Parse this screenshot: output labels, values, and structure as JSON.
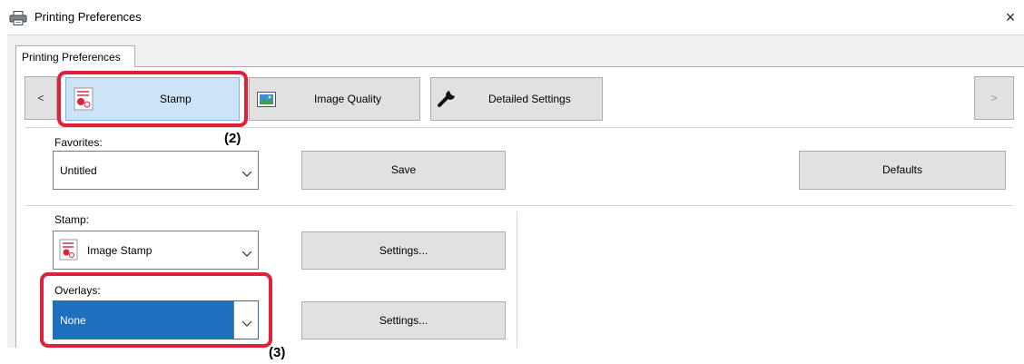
{
  "window": {
    "title": "Printing Preferences",
    "close_glyph": "×",
    "icon": "printer-icon"
  },
  "tab": {
    "label": "Printing Preferences"
  },
  "tabstrip": {
    "prev_glyph": "<",
    "next_glyph": ">",
    "buttons": [
      {
        "label": "Stamp",
        "icon": "stamp-icon",
        "selected": true
      },
      {
        "label": "Image Quality",
        "icon": "image-quality-icon",
        "selected": false
      },
      {
        "label": "Detailed Settings",
        "icon": "wrench-icon",
        "selected": false
      }
    ]
  },
  "favorites": {
    "label": "Favorites:",
    "value": "Untitled",
    "save_label": "Save",
    "defaults_label": "Defaults"
  },
  "stamp": {
    "label": "Stamp:",
    "value": "Image Stamp",
    "settings_label": "Settings..."
  },
  "overlays": {
    "label": "Overlays:",
    "value": "None",
    "settings_label": "Settings..."
  },
  "callouts": {
    "two": "(2)",
    "three": "(3)"
  },
  "colors": {
    "highlight_red": "#e0213a",
    "selected_blue": "#1f6fbf",
    "tab_selected": "#cce4f7"
  }
}
